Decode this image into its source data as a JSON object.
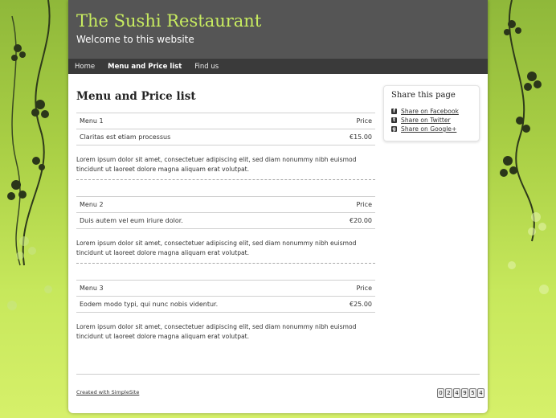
{
  "site": {
    "title": "The Sushi Restaurant",
    "subtitle": "Welcome to this website"
  },
  "nav": {
    "items": [
      {
        "label": "Home"
      },
      {
        "label": "Menu and Price list",
        "active": true
      },
      {
        "label": "Find us"
      }
    ]
  },
  "main": {
    "title": "Menu and Price list",
    "price_header": "Price",
    "menus": [
      {
        "name": "Menu 1",
        "item": "Claritas est etiam processus",
        "price": "€15.00",
        "description": "Lorem ipsum dolor sit amet, consectetuer adipiscing elit, sed diam nonummy nibh euismod tincidunt ut laoreet dolore magna aliquam erat volutpat."
      },
      {
        "name": "Menu 2",
        "item": "Duis autem vel eum iriure dolor.",
        "price": "€20.00",
        "description": "Lorem ipsum dolor sit amet, consectetuer adipiscing elit, sed diam nonummy nibh euismod tincidunt ut laoreet dolore magna aliquam erat volutpat."
      },
      {
        "name": "Menu 3",
        "item": "Eodem modo typi, qui nunc nobis videntur.",
        "price": "€25.00",
        "description": "Lorem ipsum dolor sit amet, consectetuer adipiscing elit, sed diam nonummy nibh euismod tincidunt ut laoreet dolore magna aliquam erat volutpat."
      }
    ]
  },
  "share": {
    "title": "Share this page",
    "links": [
      {
        "label": "Share on Facebook",
        "icon": "facebook-icon"
      },
      {
        "label": "Share on Twitter",
        "icon": "twitter-icon"
      },
      {
        "label": "Share on Google+",
        "icon": "google-plus-icon"
      }
    ]
  },
  "footer": {
    "credit": "Created with SimpleSite",
    "counter": [
      "0",
      "2",
      "4",
      "9",
      "5",
      "4"
    ]
  },
  "colors": {
    "title_accent": "#c8ec60",
    "header_bg": "#555555",
    "nav_bg": "#3a3a3a",
    "page_bg_green": "#b5da4e"
  }
}
